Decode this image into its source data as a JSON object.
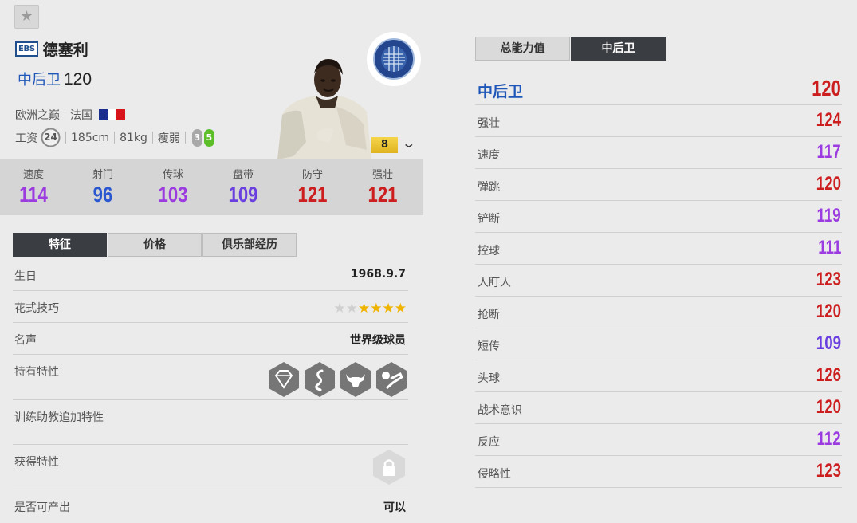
{
  "colors": {
    "purple": "#9b3be0",
    "blue": "#2a56cf",
    "red": "#cc1e1e",
    "indigo": "#6a3fe0",
    "accent_blue": "#1f57b8"
  },
  "player": {
    "season_badge": "EBS",
    "name": "德塞利",
    "position": "中后卫",
    "overall": "120",
    "team": "欧洲之巅",
    "nation": "法国",
    "wage_label": "工资",
    "wage": "24",
    "height": "185cm",
    "weight": "81kg",
    "body": "瘦弱",
    "weak_foot": "3",
    "strong_foot": "5",
    "enhance_level": "8"
  },
  "summary_stats": [
    {
      "label": "速度",
      "value": "114",
      "color": "#9b3be0"
    },
    {
      "label": "射门",
      "value": "96",
      "color": "#2a56cf"
    },
    {
      "label": "传球",
      "value": "103",
      "color": "#9b3be0"
    },
    {
      "label": "盘带",
      "value": "109",
      "color": "#6a3fe0"
    },
    {
      "label": "防守",
      "value": "121",
      "color": "#cc1e1e"
    },
    {
      "label": "强壮",
      "value": "121",
      "color": "#cc1e1e"
    }
  ],
  "left_tabs": [
    "特征",
    "价格",
    "俱乐部经历"
  ],
  "details": {
    "birthday_label": "生日",
    "birthday": "1968.9.7",
    "skill_label": "花式技巧",
    "skill_stars": 4,
    "skill_stars_max": 6,
    "rep_label": "名声",
    "rep": "世界级球员",
    "traits_label": "持有特性",
    "coach_label": "训练助教追加特性",
    "acquired_label": "获得特性",
    "tradable_label": "是否可产出",
    "tradable": "可以"
  },
  "right_tabs": [
    "总能力值",
    "中后卫"
  ],
  "position_header": {
    "label": "中后卫",
    "value": "120",
    "color": "#cc1e1e"
  },
  "attributes": [
    {
      "label": "强壮",
      "value": "124",
      "color": "#cc1e1e"
    },
    {
      "label": "速度",
      "value": "117",
      "color": "#9b3be0"
    },
    {
      "label": "弹跳",
      "value": "120",
      "color": "#cc1e1e"
    },
    {
      "label": "铲断",
      "value": "119",
      "color": "#9b3be0"
    },
    {
      "label": "控球",
      "value": "111",
      "color": "#9b3be0"
    },
    {
      "label": "人盯人",
      "value": "123",
      "color": "#cc1e1e"
    },
    {
      "label": "抢断",
      "value": "120",
      "color": "#cc1e1e"
    },
    {
      "label": "短传",
      "value": "109",
      "color": "#6a3fe0"
    },
    {
      "label": "头球",
      "value": "126",
      "color": "#cc1e1e"
    },
    {
      "label": "战术意识",
      "value": "120",
      "color": "#cc1e1e"
    },
    {
      "label": "反应",
      "value": "112",
      "color": "#9b3be0"
    },
    {
      "label": "侵略性",
      "value": "123",
      "color": "#cc1e1e"
    }
  ]
}
